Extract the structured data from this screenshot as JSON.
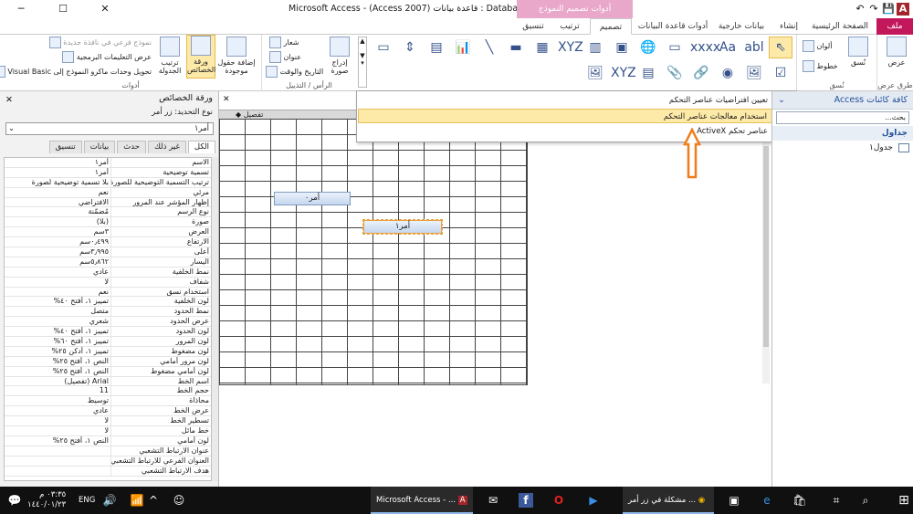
{
  "window": {
    "title": "Microsoft Access - (Access 2007) قاعدة بيانات : Database5",
    "contextual_tab": "أدوات تصميم النموذج",
    "min": "─",
    "max": "☐",
    "close": "✕"
  },
  "quick_access": [
    "↶",
    "↷",
    "💾",
    "A"
  ],
  "tabs": [
    {
      "label": "ملف",
      "active": false
    },
    {
      "label": "الصفحة الرئيسية",
      "active": false
    },
    {
      "label": "إنشاء",
      "active": false
    },
    {
      "label": "بيانات خارجية",
      "active": false
    },
    {
      "label": "أدوات قاعدة البيانات",
      "active": false
    },
    {
      "label": "تصميم",
      "active": true
    },
    {
      "label": "ترتيب",
      "active": false
    },
    {
      "label": "تنسيق",
      "active": false
    }
  ],
  "ribbon": {
    "views_group": {
      "button": "عرض",
      "label": "طرق عرض"
    },
    "themes_group": {
      "button": "نُسق",
      "colors": "ألوان",
      "fonts": "خطوط",
      "label": "نُسق"
    },
    "header_group": {
      "insert_image": "إدراج صورة",
      "logo": "شعار",
      "title": "عنوان",
      "datetime": "التاريخ والوقت",
      "label": "الرأس / التذييل"
    },
    "tools_group": {
      "add_fields": "إضافة حقول موجودة",
      "property_sheet": "ورقة الخصائص",
      "tab_order": "ترتيب الجدولة",
      "new_subform": "نموذج فرعي في نافذة جديدة",
      "view_code": "عرض التعليمات البرمجية",
      "convert_macros": "تحويل وحدات ماكرو النموذج إلى Visual Basic",
      "label": "أدوات"
    },
    "gallery_row1": [
      "⇖",
      "abl",
      "Aa",
      "xxxx",
      "▭",
      "🌐",
      "▣",
      "▥",
      "XYZ",
      "▦",
      "▬",
      "╲",
      "📊",
      "▤",
      "⇕",
      "▭"
    ],
    "gallery_row2": [
      "☑",
      "🖼",
      "◉",
      "🔗",
      "📎",
      "▤",
      "XYZ",
      "🖼"
    ]
  },
  "dropdown": {
    "items": [
      {
        "label": "تعيين افتراضيات عناصر التحكم",
        "icon": "⚒"
      },
      {
        "label": "استخدام معالجات عناصر التحكم",
        "icon": "✨"
      },
      {
        "label": "عناصر تحكم ActiveX",
        "icon": "⛭"
      }
    ]
  },
  "nav_pane": {
    "title": "كافة كائنات Access",
    "search_placeholder": "بحث...",
    "section": "جداول",
    "items": [
      "جدول١"
    ]
  },
  "design": {
    "detail_label": "تفصيل",
    "button1": "أمر٠",
    "button2": "أمر١"
  },
  "properties": {
    "title": "ورقة الخصائص",
    "selection_type": "نوع التحديد: زر أمر",
    "selected": "أمر١",
    "tabs": [
      "تنسيق",
      "بيانات",
      "حدث",
      "غير ذلك",
      "الكل"
    ],
    "active_tab": "الكل",
    "rows": [
      [
        "الاسم",
        "أمر١"
      ],
      [
        "تسمية توضيحية",
        "أمر١"
      ],
      [
        "ترتيب التسمية التوضيحية للصورة",
        "بلا تسمية توضيحية لصورة"
      ],
      [
        "مرئي",
        "نعم"
      ],
      [
        "إظهار المؤشر عند المرور",
        "الافتراضي"
      ],
      [
        "نوع الرسم",
        "مُضمّنة"
      ],
      [
        "صورة",
        "(بلا)"
      ],
      [
        "العرض",
        "٣سم"
      ],
      [
        "الارتفاع",
        "٠٫٤٩٩سم"
      ],
      [
        "أعلى",
        "٣٫٩٩٥سم"
      ],
      [
        "اليسار",
        "٥٫٨٦٢سم"
      ],
      [
        "نمط الخلفية",
        "عادي"
      ],
      [
        "شفاف",
        "لا"
      ],
      [
        "استخدام نسق",
        "نعم"
      ],
      [
        "لون الخلفية",
        "تمييز ١، أفتح ٤٠%"
      ],
      [
        "نمط الحدود",
        "متصل"
      ],
      [
        "عرض الحدود",
        "شعري"
      ],
      [
        "لون الحدود",
        "تمييز ١، أفتح ٤٠%"
      ],
      [
        "لون المرور",
        "تمييز ١، أفتح ٦٠%"
      ],
      [
        "لون مضغوط",
        "تمييز ١، أدكن ٢٥%"
      ],
      [
        "لون مرور أمامي",
        "النص ١، أفتح ٢٥%"
      ],
      [
        "لون أمامي مضغوط",
        "النص ١، أفتح ٢٥%"
      ],
      [
        "اسم الخط",
        "Arial (تفصيل)"
      ],
      [
        "حجم الخط",
        "11"
      ],
      [
        "محاذاة",
        "توسيط"
      ],
      [
        "عرض الخط",
        "عادي"
      ],
      [
        "تسطير الخط",
        "لا"
      ],
      [
        "خط مائل",
        "لا"
      ],
      [
        "لون أمامي",
        "النص ١، أفتح ٢٥%"
      ],
      [
        "عنوان الارتباط التشعبي",
        ""
      ],
      [
        "العنوان الفرعي للارتباط التشعبي",
        ""
      ],
      [
        "هدف الارتباط التشعبي",
        ""
      ]
    ]
  },
  "taskbar": {
    "start": "⊞",
    "clock_time": "٠٣:٣٥ م",
    "clock_date": "١٤٤٠/٠١/٢٣",
    "lang": "ENG",
    "access_label": "Microsoft Access - ...",
    "chrome_label": "مشكلة في زر أمر ...",
    "icons": [
      "✉",
      "f",
      "O",
      "▶",
      "◉",
      "▣",
      "e",
      "🛍",
      "⌗",
      "⌕"
    ]
  }
}
